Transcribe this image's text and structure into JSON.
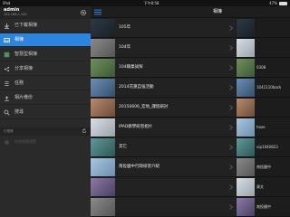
{
  "status_bar": {
    "carrier": "iPad",
    "time": "下午8:58",
    "battery": "47%"
  },
  "account": {
    "user": "admin",
    "address": "192.168.1.100"
  },
  "sidebar": {
    "items": [
      {
        "label": "已下載相簿",
        "icon": "download-icon",
        "active": false
      },
      {
        "label": "相簿",
        "icon": "album-icon",
        "active": true
      },
      {
        "label": "智慧型相簿",
        "icon": "smart-album-icon",
        "active": false
      },
      {
        "label": "分享相簿",
        "icon": "share-icon",
        "active": false
      },
      {
        "label": "任務",
        "icon": "task-icon",
        "active": false
      },
      {
        "label": "相片備份",
        "icon": "backup-icon",
        "active": false
      },
      {
        "label": "搜尋",
        "icon": "search-icon",
        "active": false
      }
    ],
    "section_header": "已連線",
    "disabled_item": "本地相簿瀏覽"
  },
  "topbar": {
    "title": "相簿"
  },
  "albums": [
    {
      "label": "105年",
      "thumb": "t-dark"
    },
    {
      "label": "104年",
      "thumb": "t-grey"
    },
    {
      "label": "104職業試探",
      "thumb": "t-green"
    },
    {
      "label": "2014花蓮自強活動",
      "thumb": "t-blue"
    },
    {
      "label": "20150606_宏地_課程研討",
      "thumb": "t-warm"
    },
    {
      "label": "IPAD教學研習相片",
      "thumb": "t-light"
    },
    {
      "label": "其它",
      "thumb": "t-teal"
    },
    {
      "label": "南投國中行政研習介紹",
      "thumb": "t-sky"
    },
    {
      "label": "",
      "thumb": "t-purple"
    },
    {
      "label": "",
      "thumb": "t-grey"
    }
  ],
  "right_pane": [
    {
      "label": "",
      "thumb": "t-dark"
    },
    {
      "label": "",
      "thumb": "t-light"
    },
    {
      "label": "0308",
      "thumb": "t-green"
    },
    {
      "label": "1041110back",
      "thumb": "t-blue"
    },
    {
      "label": "",
      "thumb": "t-warm"
    },
    {
      "label": "haze",
      "thumb": "t-sky"
    },
    {
      "label": "vip1040823",
      "thumb": "t-teal"
    },
    {
      "label": "南投國中",
      "thumb": "t-grey"
    },
    {
      "label": "資文",
      "thumb": "t-light"
    },
    {
      "label": "南投國中",
      "thumb": "t-purple"
    }
  ],
  "colors": {
    "accent": "#2d84de",
    "sidebar_bg": "#2a2a2a",
    "list_bg": "#222222"
  }
}
